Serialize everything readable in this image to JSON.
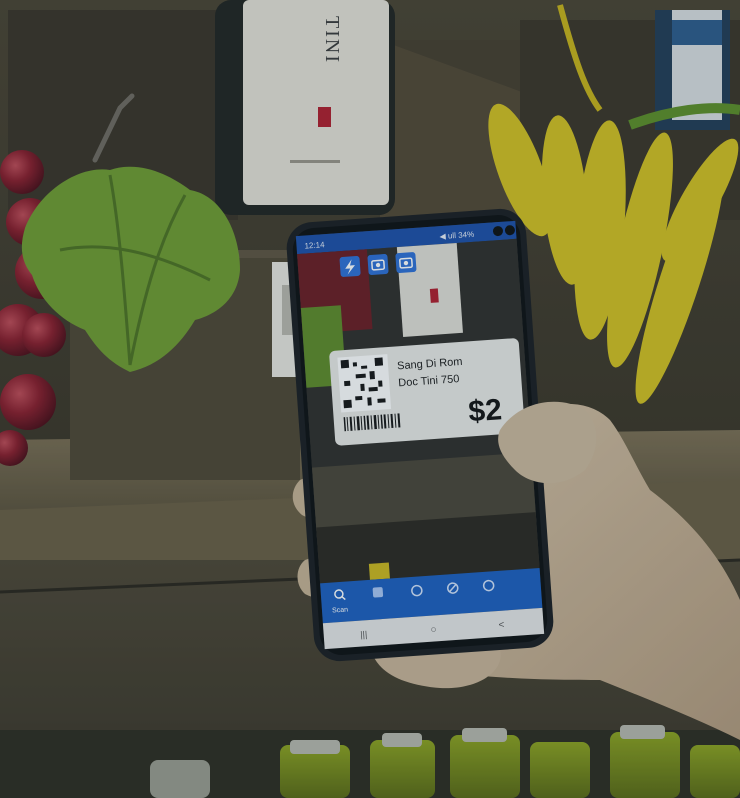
{
  "photo": {
    "wine_label_text": "TINI",
    "phone": {
      "status": {
        "time": "12:14",
        "battery": "◀ ull 34%"
      },
      "toolbar_icons": [
        "flash-icon",
        "camera-icon",
        "camera-switch-icon"
      ],
      "price_tag": {
        "line1": "Sang Di Rom",
        "line2": "Doc Tini 750",
        "price": "$2"
      },
      "bottom_nav": {
        "scan_label": "Scan",
        "icons": [
          "scan-icon",
          "tag-icon",
          "sync-icon",
          "cancel-icon",
          "settings-icon"
        ]
      },
      "system_nav": {
        "recents": "|||",
        "home": "○",
        "back": "<"
      }
    }
  },
  "colors": {
    "wood_dark": "#3f3726",
    "wood_light": "#7a6a4c",
    "grape": "#7a1422",
    "leaf": "#6e9a2c",
    "wheat": "#d6c21c",
    "app_blue": "#1f4fa0",
    "phone_body": "#1c2024",
    "skin": "#c9b49a"
  }
}
